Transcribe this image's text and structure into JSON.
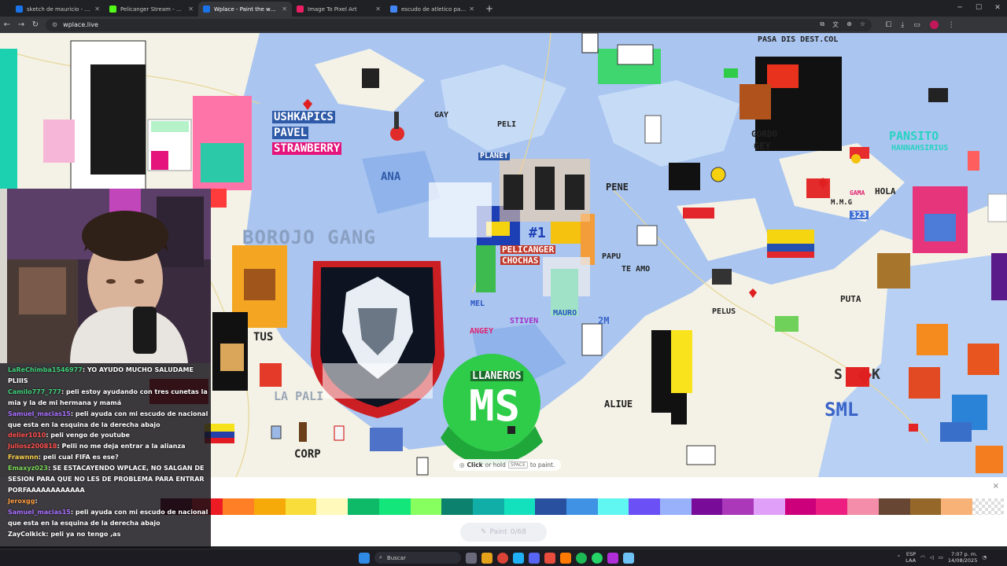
{
  "browser": {
    "tabs": [
      {
        "title": "sketch de mauricio - Google Dr...",
        "color": "#1a73e8",
        "active": false
      },
      {
        "title": "Pelicanger Stream - Watch Live...",
        "color": "#53fc18",
        "active": false
      },
      {
        "title": "Wplace - Paint the world",
        "color": "#1a73e8",
        "active": true
      },
      {
        "title": "Image To Pixel Art",
        "color": "#e91e63",
        "active": false
      },
      {
        "title": "escudo de atletico parceros - B...",
        "color": "#4285f4",
        "active": false
      }
    ],
    "new_tab": "+",
    "url": "wplace.live"
  },
  "map": {
    "labels": {
      "ushkapics": "USHKAPICS",
      "pavel": "PAVEL",
      "strawberry": "STRAWBERRY",
      "borojo": "BOROJO GANG",
      "pelicanger": "PELICANGER",
      "chochas": "CHOCHAS",
      "rank1": "#1",
      "pene": "PENE",
      "teamo": "TE AMO",
      "putoqueen": "PUTA",
      "pelus": "PELUS",
      "hola": "HOLA",
      "sml": "SML",
      "sok": "S",
      "k": "K",
      "alive": "ALIUE",
      "corp": "CORP",
      "lapali": "LA PALI",
      "tus": "TUS",
      "llaneros": "LLANEROS",
      "ms": "MS",
      "pasa": "PASA DIS DEST.COL",
      "gordo": "GORDO",
      "gey": "GEY",
      "pansito": "PANSITO",
      "hannahsirius": "HANNAHSIRIUS",
      "mauro": "MAURO",
      "stiven": "STIVEN",
      "angey": "ANGEY",
      "peli": "PELI",
      "gay": "GAY",
      "ana": "ANA",
      "planet": "PLANET",
      "papu": "PAPU",
      "num323": "323",
      "mmg": "M.M.G",
      "gama": "GAMA",
      "num2m": "2M",
      "mel": "MEL"
    },
    "hint": {
      "click": "Click",
      "rest": "or hold",
      "key": "SPACE",
      "end": "to paint."
    }
  },
  "palette": {
    "colors": [
      "#600018",
      "#ed1c24",
      "#ff7f27",
      "#f6aa09",
      "#f9dd3b",
      "#fffabc",
      "#0eb968",
      "#13e67b",
      "#87ff5e",
      "#0c816e",
      "#10aea6",
      "#13e1be",
      "#28509e",
      "#4093e4",
      "#60f7f2",
      "#6b50f6",
      "#99b1fb",
      "#780c99",
      "#aa38b9",
      "#e09ff9",
      "#cb007a",
      "#ec1f80",
      "#f38da9",
      "#684634",
      "#95682a",
      "#f8b277"
    ],
    "paint_label": "Paint",
    "paint_count": "0/68",
    "close": "×"
  },
  "chat": [
    {
      "user": "LaReChimba1546977",
      "color": "#3fd17a",
      "text": ": YO AYUDO MUCHO SALUDAME PLIIIS"
    },
    {
      "user": "Camilo777_777",
      "color": "#3fd17a",
      "text": ": peli estoy ayudando con tres cunetas la mia y la de mi hermana y mamá"
    },
    {
      "user": "Samuel_macias15",
      "color": "#a970ff",
      "text": ": peli ayuda con mi escudo de nacional que esta en la esquina de la derecha abajo"
    },
    {
      "user": "delier1010",
      "color": "#ff4f4f",
      "text": ": peli vengo de youtube"
    },
    {
      "user": "Juliosz200818",
      "color": "#ff4f4f",
      "text": ": Pelli no me deja entrar a la alianza"
    },
    {
      "user": "Frawnnn",
      "color": "#ffd54f",
      "text": ": peli cual FIFA es ese?"
    },
    {
      "user": "Emaxyz023",
      "color": "#7cd85a",
      "text": ": SE ESTACAYENDO WPLACE, NO SALGAN DE SESION PARA QUE NO LES DE PROBLEMA PARA ENTRAR PORFAAAAAAAAAAAA"
    },
    {
      "user": "Jeroxgg",
      "color": "#ff9f43",
      "text": ":"
    },
    {
      "user": "Samuel_macias15",
      "color": "#a970ff",
      "text": ": peli ayuda con mi escudo de nacional que esta en la esquina de la derecha abajo"
    },
    {
      "user": "ZayColkick",
      "color": "#ffffff",
      "text": ": peli ya no tengo ,as"
    }
  ],
  "taskbar": {
    "search": "Buscar",
    "lang_top": "ESP",
    "lang_bottom": "LAA",
    "time": "7:07 p. m.",
    "date": "14/08/2025"
  }
}
